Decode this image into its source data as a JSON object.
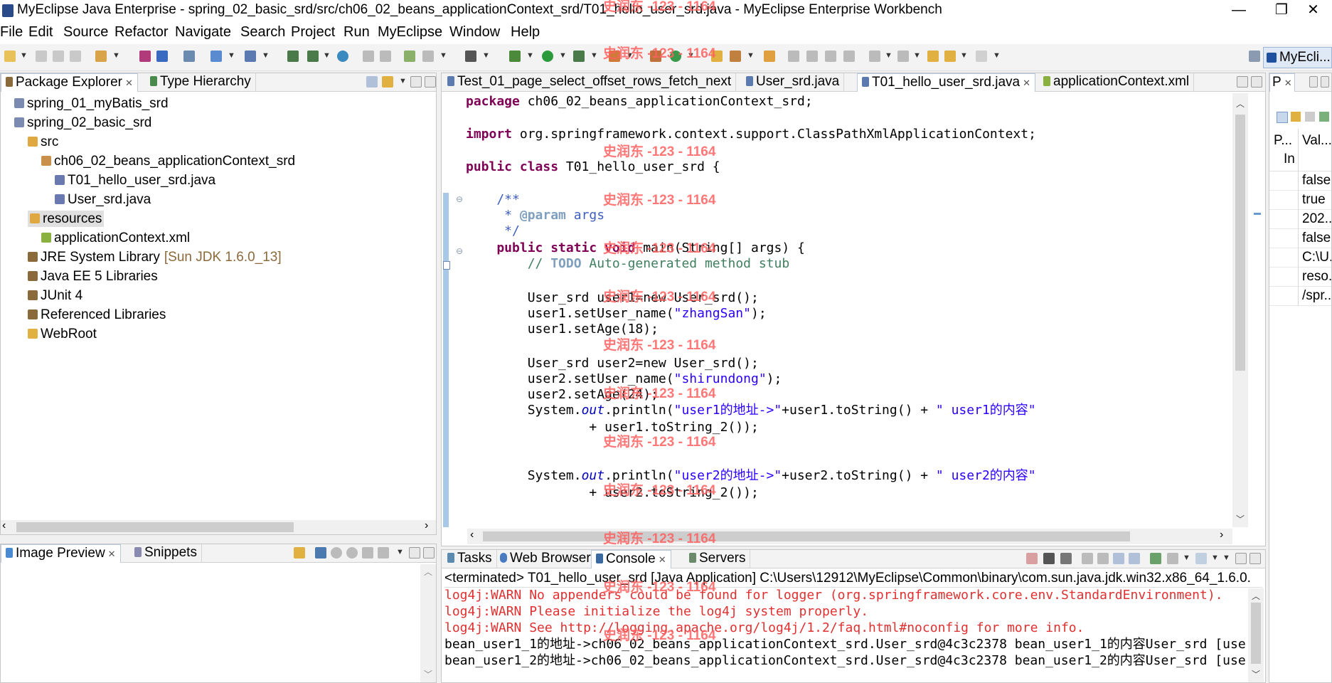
{
  "window": {
    "title": "MyEclipse Java Enterprise - spring_02_basic_srd/src/ch06_02_beans_applicationContext_srd/T01_hello_user_srd.java - MyEclipse Enterprise Workbench",
    "minimize": "—",
    "restore": "❐",
    "close": "✕"
  },
  "menu": [
    "File",
    "Edit",
    "Source",
    "Refactor",
    "Navigate",
    "Search",
    "Project",
    "Run",
    "MyEclipse",
    "Window",
    "Help"
  ],
  "perspective": {
    "label": "MyEcli..."
  },
  "watermark": "史润东 -123 - 1164",
  "package_explorer": {
    "tabs": [
      "Package Explorer",
      "Type Hierarchy"
    ],
    "items": [
      {
        "label": "spring_01_myBatis_srd",
        "indent": 1,
        "icon": "project-icon"
      },
      {
        "label": "spring_02_basic_srd",
        "indent": 1,
        "icon": "project-icon"
      },
      {
        "label": "src",
        "indent": 2,
        "icon": "source-folder-icon"
      },
      {
        "label": "ch06_02_beans_applicationContext_srd",
        "indent": 3,
        "icon": "package-icon"
      },
      {
        "label": "T01_hello_user_srd.java",
        "indent": 4,
        "icon": "java-file-icon"
      },
      {
        "label": "User_srd.java",
        "indent": 4,
        "icon": "java-file-icon"
      },
      {
        "label": "resources",
        "indent": 2,
        "icon": "source-folder-icon",
        "selected": true
      },
      {
        "label": "applicationContext.xml",
        "indent": 3,
        "icon": "xml-file-icon"
      },
      {
        "label": "JRE System Library",
        "suffix": "[Sun JDK 1.6.0_13]",
        "indent": 2,
        "icon": "library-icon"
      },
      {
        "label": "Java EE 5 Libraries",
        "indent": 2,
        "icon": "library-icon"
      },
      {
        "label": "JUnit 4",
        "indent": 2,
        "icon": "library-icon"
      },
      {
        "label": "Referenced Libraries",
        "indent": 2,
        "icon": "library-icon"
      },
      {
        "label": "WebRoot",
        "indent": 2,
        "icon": "folder-icon"
      }
    ]
  },
  "image_preview": {
    "tabs": [
      "Image Preview",
      "Snippets"
    ]
  },
  "editor": {
    "tabs": [
      {
        "label": "Test_01_page_select_offset_rows_fetch_next",
        "active": false
      },
      {
        "label": "User_srd.java",
        "active": false
      },
      {
        "label": "T01_hello_user_srd.java",
        "active": true
      },
      {
        "label": "applicationContext.xml",
        "active": false
      }
    ],
    "lines": {
      "l1_kw": "package",
      "l1_rest": " ch06_02_beans_applicationContext_srd;",
      "l2_kw": "import",
      "l2_rest": " org.springframework.context.support.ClassPathXmlApplicationContext;",
      "l3_kw": "public class",
      "l3_rest": " T01_hello_user_srd {",
      "l4": "    /**",
      "l5_a": "     * ",
      "l5_b": "@param",
      "l5_c": " args",
      "l6": "     */",
      "l7_kw": "    public static void",
      "l7_rest": " main(String[] args) {",
      "l8_a": "        // ",
      "l8_b": "TODO",
      "l8_c": " Auto-generated method stub",
      "l9": "        User_srd user1=new User_srd();",
      "l10_a": "        user1.setUser_name(",
      "l10_b": "\"zhangSan\"",
      "l10_c": ");",
      "l11": "        user1.setAge(18);",
      "l12": "        User_srd user2=new User_srd();",
      "l13_a": "        user2.setUser_name(",
      "l13_b": "\"shirundong\"",
      "l13_c": ");",
      "l14": "        user2.setAge(24);",
      "l15_a": "        System.",
      "l15_b": "out",
      "l15_c": ".println(",
      "l15_d": "\"user1的地址->\"",
      "l15_e": "+user1.toString() + ",
      "l15_f": "\" user1的内容\"",
      "l16": "                + user1.toString_2());",
      "l17_a": "        System.",
      "l17_b": "out",
      "l17_c": ".println(",
      "l17_d": "\"user2的地址->\"",
      "l17_e": "+user2.toString() + ",
      "l17_f": "\" user2的内容\"",
      "l18": "                + user2.toString_2());"
    }
  },
  "console": {
    "tabs": [
      "Tasks",
      "Web Browser",
      "Console",
      "Servers"
    ],
    "header": "<terminated> T01_hello_user_srd [Java Application] C:\\Users\\12912\\MyEclipse\\Common\\binary\\com.sun.java.jdk.win32.x86_64_1.6.0.",
    "lines": [
      "log4j:WARN No appenders could be found for logger (org.springframework.core.env.StandardEnvironment).",
      "log4j:WARN Please initialize the log4j system properly.",
      "log4j:WARN See http://logging.apache.org/log4j/1.2/faq.html#noconfig for more info.",
      "bean_user1_1的地址->ch06_02_beans_applicationContext_srd.User_srd@4c3c2378 bean_user1_1的内容User_srd [use",
      "bean_user1_2的地址->ch06_02_beans_applicationContext_srd.User_srd@4c3c2378 bean_user1_2的内容User_srd [use"
    ]
  },
  "properties": {
    "tab": "P",
    "col1": "P...",
    "col2": "Val...",
    "row0": "In",
    "values": [
      "false",
      "true",
      "202...",
      "false",
      "C:\\U...",
      "reso...",
      "/spr..."
    ]
  }
}
